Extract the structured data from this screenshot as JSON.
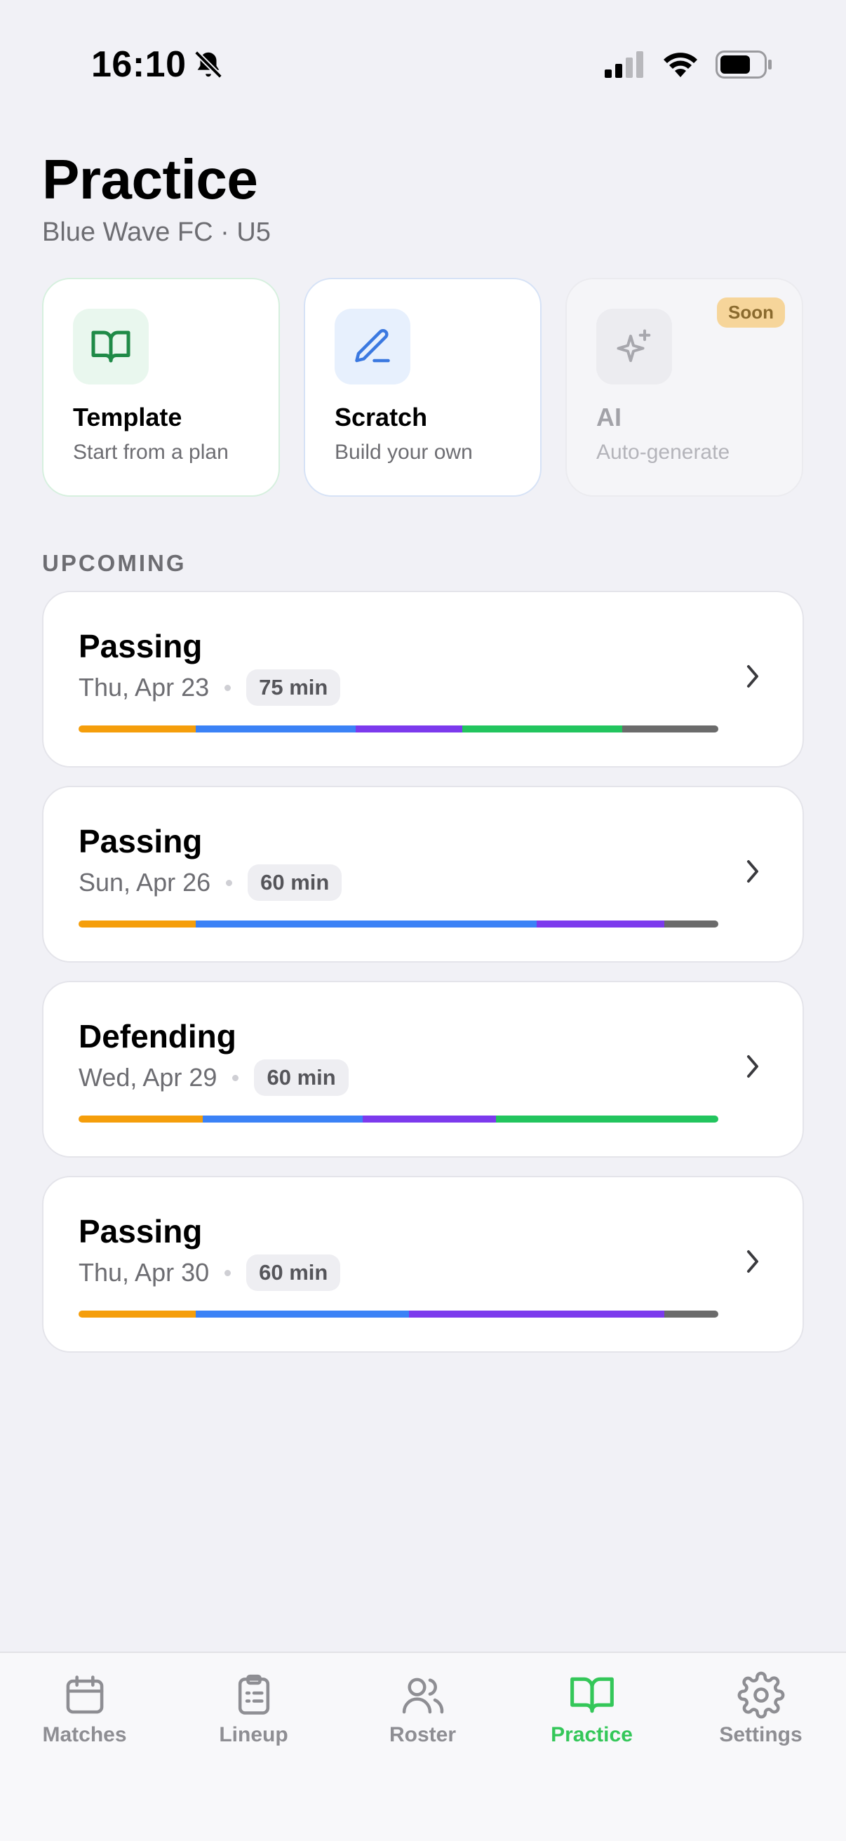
{
  "status_bar": {
    "time": "16:10"
  },
  "header": {
    "title": "Practice",
    "subtitle": "Blue Wave FC · U5"
  },
  "create_options": [
    {
      "title": "Template",
      "description": "Start from a plan",
      "icon": "book-open-icon"
    },
    {
      "title": "Scratch",
      "description": "Build your own",
      "icon": "pencil-icon"
    },
    {
      "title": "AI",
      "description": "Auto-generate",
      "icon": "sparkles-icon",
      "badge": "Soon",
      "disabled": true
    }
  ],
  "upcoming": {
    "label": "UPCOMING",
    "practices": [
      {
        "title": "Passing",
        "date": "Thu, Apr 23",
        "duration": "75 min",
        "segments": [
          {
            "color": "#f59e0b",
            "fraction": 0.183
          },
          {
            "color": "#3b82f6",
            "fraction": 0.25
          },
          {
            "color": "#7c3aed",
            "fraction": 0.167
          },
          {
            "color": "#22c55e",
            "fraction": 0.25
          },
          {
            "color": "#6b6b6b",
            "fraction": 0.15
          }
        ]
      },
      {
        "title": "Passing",
        "date": "Sun, Apr 26",
        "duration": "60 min",
        "segments": [
          {
            "color": "#f59e0b",
            "fraction": 0.183
          },
          {
            "color": "#3b82f6",
            "fraction": 0.533
          },
          {
            "color": "#7c3aed",
            "fraction": 0.2
          },
          {
            "color": "#6b6b6b",
            "fraction": 0.084
          }
        ]
      },
      {
        "title": "Defending",
        "date": "Wed, Apr 29",
        "duration": "60 min",
        "segments": [
          {
            "color": "#f59e0b",
            "fraction": 0.194
          },
          {
            "color": "#3b82f6",
            "fraction": 0.25
          },
          {
            "color": "#7c3aed",
            "fraction": 0.208
          },
          {
            "color": "#22c55e",
            "fraction": 0.348
          }
        ]
      },
      {
        "title": "Passing",
        "date": "Thu, Apr 30",
        "duration": "60 min",
        "segments": [
          {
            "color": "#f59e0b",
            "fraction": 0.183
          },
          {
            "color": "#3b82f6",
            "fraction": 0.333
          },
          {
            "color": "#7c3aed",
            "fraction": 0.4
          },
          {
            "color": "#6b6b6b",
            "fraction": 0.084
          }
        ]
      }
    ]
  },
  "tab_bar": {
    "items": [
      {
        "label": "Matches",
        "icon": "calendar-icon",
        "active": false
      },
      {
        "label": "Lineup",
        "icon": "clipboard-list-icon",
        "active": false
      },
      {
        "label": "Roster",
        "icon": "users-icon",
        "active": false
      },
      {
        "label": "Practice",
        "icon": "book-open-icon",
        "active": true
      },
      {
        "label": "Settings",
        "icon": "gear-icon",
        "active": false
      }
    ]
  },
  "colors": {
    "accent_green": "#34c759",
    "background": "#f1f1f6",
    "muted_text": "#6d6d72"
  }
}
